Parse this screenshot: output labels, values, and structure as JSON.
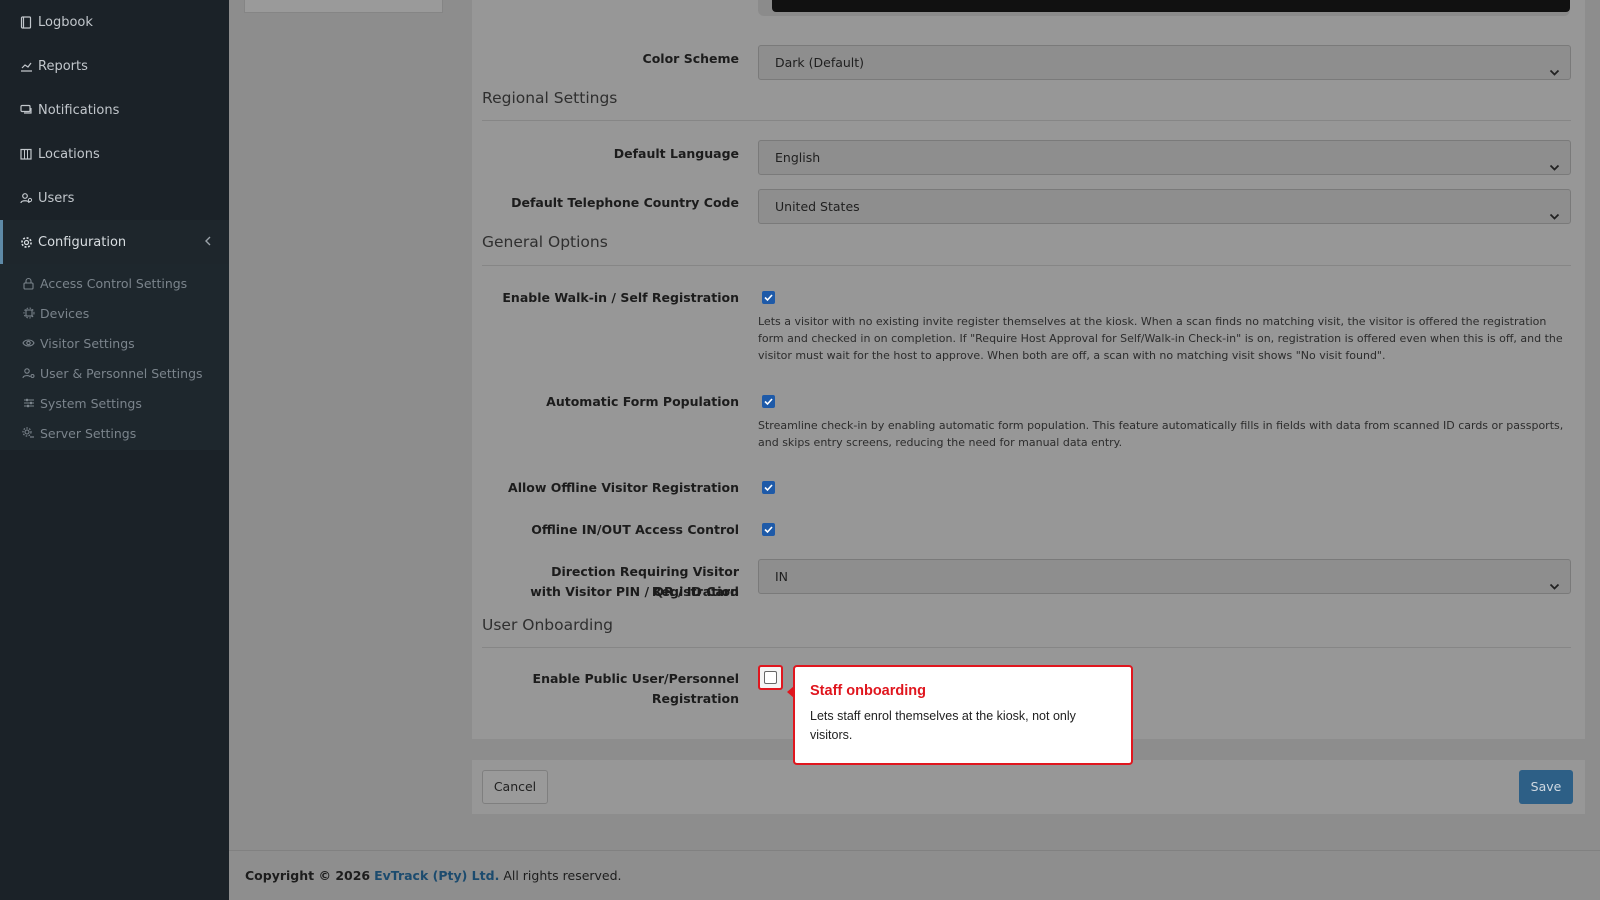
{
  "sidebar": {
    "items": [
      {
        "label": "Logbook",
        "icon": "book-icon"
      },
      {
        "label": "Reports",
        "icon": "chart-icon"
      },
      {
        "label": "Notifications",
        "icon": "chat-icon"
      },
      {
        "label": "Locations",
        "icon": "building-icon"
      },
      {
        "label": "Users",
        "icon": "users-icon"
      },
      {
        "label": "Configuration",
        "icon": "gear-icon"
      }
    ],
    "subitems": [
      {
        "label": "Access Control Settings",
        "icon": "lock-icon"
      },
      {
        "label": "Devices",
        "icon": "cpu-icon"
      },
      {
        "label": "Visitor Settings",
        "icon": "eye-icon"
      },
      {
        "label": "User & Personnel Settings",
        "icon": "user-gear-icon"
      },
      {
        "label": "System Settings",
        "icon": "sliders-icon"
      },
      {
        "label": "Server Settings",
        "icon": "server-gear-icon"
      }
    ]
  },
  "form": {
    "color_scheme": {
      "label": "Color Scheme",
      "value": "Dark (Default)"
    },
    "regional_title": "Regional Settings",
    "default_language": {
      "label": "Default Language",
      "value": "English"
    },
    "country_code": {
      "label": "Default Telephone Country Code",
      "value": "United States"
    },
    "general_title": "General Options",
    "walkin": {
      "label": "Enable Walk-in / Self Registration",
      "checked": true,
      "help": "Lets a visitor with no existing invite register themselves at the kiosk. When a scan finds no matching visit, the visitor is offered the registration form and checked in on completion. If \"Require Host Approval for Self/Walk-in Check-in\" is on, registration is offered even when this is off, and the visitor must wait for the host to approve. When both are off, a scan with no matching visit shows \"No visit found\"."
    },
    "auto_form": {
      "label": "Automatic Form Population",
      "checked": true,
      "help": "Streamline check-in by enabling automatic form population. This feature automatically fills in fields with data from scanned ID cards or passports, and skips entry screens, reducing the need for manual data entry."
    },
    "offline_reg": {
      "label": "Allow Offline Visitor Registration",
      "checked": true
    },
    "offline_access": {
      "label": "Offline IN/OUT Access Control",
      "checked": true
    },
    "direction": {
      "label_line1": "Direction Requiring Visitor Registration",
      "label_line2": "with Visitor PIN / QR / ID Card",
      "value": "IN"
    },
    "onboarding_title": "User Onboarding",
    "public_reg": {
      "label_line1": "Enable Public User/Personnel",
      "label_line2": "Registration",
      "checked": false
    }
  },
  "buttons": {
    "cancel": "Cancel",
    "save": "Save"
  },
  "tooltip": {
    "title": "Staff onboarding",
    "body": "Lets staff enrol themselves at the kiosk, not only visitors."
  },
  "footer": {
    "prefix": "Copyright © 2026",
    "brand": "EvTrack (Pty) Ltd.",
    "suffix": "All rights reserved."
  },
  "colors": {
    "highlight": "#e0161e",
    "save_button": "#2d5f86",
    "checkbox": "#1e5aa8",
    "sidebar": "#1b2228"
  }
}
